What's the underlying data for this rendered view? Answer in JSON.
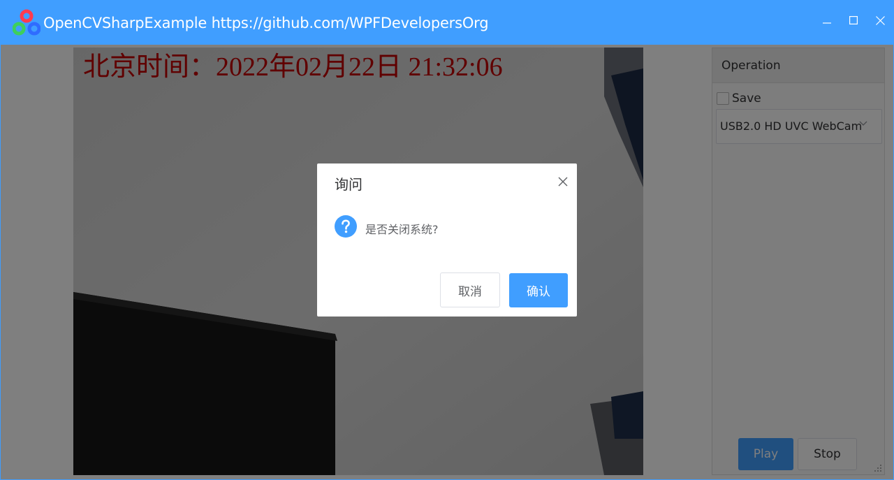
{
  "window": {
    "title": "OpenCVSharpExample https://github.com/WPFDevelopersOrg",
    "accent_color": "#409eff",
    "controls": [
      "minimize-icon",
      "maximize-icon",
      "close-icon"
    ]
  },
  "video": {
    "overlay_text": "北京时间：2022年02月22日 21:32:06",
    "overlay_color": "#c00000"
  },
  "panel": {
    "title": "Operation",
    "save_label": "Save",
    "save_checked": false,
    "camera_selected": "USB2.0 HD UVC WebCam",
    "play_label": "Play",
    "stop_label": "Stop"
  },
  "dialog": {
    "title": "询问",
    "message": "是否关闭系统?",
    "icon": "question-icon",
    "cancel_label": "取消",
    "confirm_label": "确认"
  }
}
